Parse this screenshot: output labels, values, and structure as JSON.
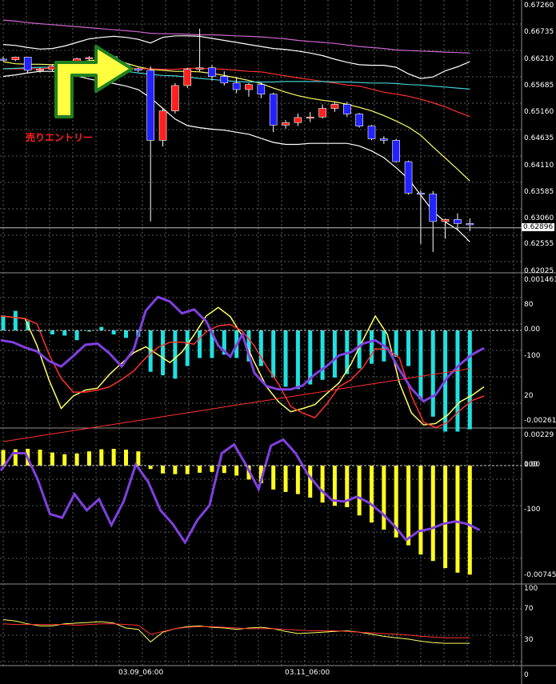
{
  "colors": {
    "background": "#000000",
    "grid": "#5a5a5a",
    "bull_candle": "#ff2020",
    "bear_candle": "#2222ff",
    "wick": "#ffffff",
    "bollinger": "#ffffff",
    "ma_fast": "#ffff66",
    "ma_mid": "#ff3030",
    "ma_cyan": "#40d0d0",
    "ma_slow": "#cc66cc",
    "osc_purple": "#8040e0",
    "histo_cyan": "#20e0e0",
    "histo_yellow": "#ffff20",
    "arrow_fill": "#ffff40",
    "arrow_border": "#208020",
    "entry_text": "#ff2020"
  },
  "annotation": {
    "entry_label": "売りエントリー"
  },
  "price_axis": {
    "labels": [
      "0.67260",
      "0.66735",
      "0.66210",
      "0.65685",
      "0.65160",
      "0.64635",
      "0.64110",
      "0.63585",
      "0.63060",
      "0.62555",
      "0.62025"
    ],
    "current_price": "0.62896"
  },
  "osc1_axis": {
    "labels": [
      "0.001461",
      "80",
      "0.00",
      "-100",
      "20",
      "-0.002618"
    ],
    "values": [
      0.001461,
      80,
      0,
      -100,
      20,
      -0.002618
    ]
  },
  "osc2_axis": {
    "labels": [
      "0.00229",
      "100",
      "0.00",
      "-100",
      "-0.00745"
    ],
    "values": [
      0.00229,
      100,
      0,
      -100,
      -0.00745
    ]
  },
  "osc3_axis": {
    "labels": [
      "100",
      "70",
      "30",
      "0"
    ],
    "values": [
      100,
      70,
      30,
      0
    ]
  },
  "time_axis": {
    "labels": [
      "03.09_06:00",
      "03.11_06:00"
    ]
  },
  "chart_data": [
    {
      "type": "candlestick",
      "ylim": [
        0.62025,
        0.6726
      ],
      "candles": [
        {
          "o": 0.6622,
          "h": 0.6627,
          "l": 0.6618,
          "c": 0.6621
        },
        {
          "o": 0.6621,
          "h": 0.6627,
          "l": 0.6618,
          "c": 0.6626
        },
        {
          "o": 0.6626,
          "h": 0.6626,
          "l": 0.6596,
          "c": 0.66
        },
        {
          "o": 0.66,
          "h": 0.6605,
          "l": 0.6595,
          "c": 0.6602
        },
        {
          "o": 0.6602,
          "h": 0.6612,
          "l": 0.6598,
          "c": 0.6608
        },
        {
          "o": 0.6608,
          "h": 0.6615,
          "l": 0.66,
          "c": 0.6612
        },
        {
          "o": 0.6612,
          "h": 0.6625,
          "l": 0.661,
          "c": 0.6623
        },
        {
          "o": 0.6623,
          "h": 0.6628,
          "l": 0.6619,
          "c": 0.6625
        },
        {
          "o": 0.6625,
          "h": 0.6633,
          "l": 0.6621,
          "c": 0.6627
        },
        {
          "o": 0.6627,
          "h": 0.6628,
          "l": 0.661,
          "c": 0.6612
        },
        {
          "o": 0.6612,
          "h": 0.6615,
          "l": 0.6602,
          "c": 0.6603
        },
        {
          "o": 0.6603,
          "h": 0.6605,
          "l": 0.6597,
          "c": 0.66
        },
        {
          "o": 0.66,
          "h": 0.6608,
          "l": 0.6302,
          "c": 0.6462
        },
        {
          "o": 0.6462,
          "h": 0.6525,
          "l": 0.645,
          "c": 0.652
        },
        {
          "o": 0.652,
          "h": 0.6575,
          "l": 0.6515,
          "c": 0.657
        },
        {
          "o": 0.657,
          "h": 0.6605,
          "l": 0.6565,
          "c": 0.6602
        },
        {
          "o": 0.6602,
          "h": 0.6682,
          "l": 0.6598,
          "c": 0.6605
        },
        {
          "o": 0.6605,
          "h": 0.661,
          "l": 0.658,
          "c": 0.6588
        },
        {
          "o": 0.6588,
          "h": 0.6598,
          "l": 0.657,
          "c": 0.6575
        },
        {
          "o": 0.6575,
          "h": 0.6586,
          "l": 0.6555,
          "c": 0.6562
        },
        {
          "o": 0.6562,
          "h": 0.6575,
          "l": 0.6548,
          "c": 0.6572
        },
        {
          "o": 0.6572,
          "h": 0.6576,
          "l": 0.6545,
          "c": 0.6553
        },
        {
          "o": 0.6553,
          "h": 0.6556,
          "l": 0.6478,
          "c": 0.6492
        },
        {
          "o": 0.6492,
          "h": 0.6502,
          "l": 0.6485,
          "c": 0.6497
        },
        {
          "o": 0.6497,
          "h": 0.6515,
          "l": 0.649,
          "c": 0.6507
        },
        {
          "o": 0.6507,
          "h": 0.6518,
          "l": 0.6498,
          "c": 0.6508
        },
        {
          "o": 0.6508,
          "h": 0.6533,
          "l": 0.6505,
          "c": 0.6525
        },
        {
          "o": 0.6525,
          "h": 0.6538,
          "l": 0.6518,
          "c": 0.6533
        },
        {
          "o": 0.6533,
          "h": 0.6538,
          "l": 0.6508,
          "c": 0.6514
        },
        {
          "o": 0.6514,
          "h": 0.6516,
          "l": 0.6487,
          "c": 0.649
        },
        {
          "o": 0.649,
          "h": 0.6492,
          "l": 0.6462,
          "c": 0.6465
        },
        {
          "o": 0.6465,
          "h": 0.647,
          "l": 0.6455,
          "c": 0.6462
        },
        {
          "o": 0.6462,
          "h": 0.6465,
          "l": 0.6418,
          "c": 0.642
        },
        {
          "o": 0.642,
          "h": 0.6422,
          "l": 0.6355,
          "c": 0.6358
        },
        {
          "o": 0.6358,
          "h": 0.6364,
          "l": 0.6258,
          "c": 0.6356
        },
        {
          "o": 0.6356,
          "h": 0.6362,
          "l": 0.6242,
          "c": 0.6302
        },
        {
          "o": 0.6302,
          "h": 0.6308,
          "l": 0.6268,
          "c": 0.6306
        },
        {
          "o": 0.6306,
          "h": 0.6318,
          "l": 0.6285,
          "c": 0.6298
        },
        {
          "o": 0.6298,
          "h": 0.6308,
          "l": 0.6283,
          "c": 0.6296
        }
      ],
      "series": [
        {
          "color": "#ffffff",
          "values": [
            0.6651,
            0.6649,
            0.6645,
            0.6642,
            0.6643,
            0.6648,
            0.6655,
            0.6662,
            0.6665,
            0.6667,
            0.6665,
            0.6661,
            0.6654,
            0.6665,
            0.6668,
            0.6668,
            0.6667,
            0.6663,
            0.6659,
            0.6655,
            0.6651,
            0.6647,
            0.6643,
            0.6641,
            0.6638,
            0.6634,
            0.6629,
            0.6622,
            0.6616,
            0.6611,
            0.661,
            0.661,
            0.6606,
            0.6593,
            0.6584,
            0.6587,
            0.6599,
            0.6607,
            0.6617
          ]
        },
        {
          "color": "#ffff66",
          "values": [
            0.6617,
            0.6613,
            0.6612,
            0.6612,
            0.6611,
            0.6613,
            0.6616,
            0.6619,
            0.6621,
            0.6622,
            0.6614,
            0.6607,
            0.6602,
            0.66,
            0.6598,
            0.6598,
            0.6597,
            0.6594,
            0.659,
            0.6585,
            0.658,
            0.6574,
            0.6565,
            0.6557,
            0.655,
            0.6545,
            0.6541,
            0.6538,
            0.6533,
            0.6527,
            0.652,
            0.6511,
            0.65,
            0.6488,
            0.6472,
            0.6449,
            0.6427,
            0.6405,
            0.6382
          ]
        },
        {
          "color": "#ff3030",
          "values": [
            0.6603,
            0.6603,
            0.6603,
            0.6603,
            0.6604,
            0.6605,
            0.6606,
            0.6607,
            0.6607,
            0.6607,
            0.6605,
            0.6603,
            0.6603,
            0.6602,
            0.6602,
            0.6604,
            0.6604,
            0.6603,
            0.6602,
            0.66,
            0.6598,
            0.6597,
            0.6593,
            0.6589,
            0.6585,
            0.6582,
            0.6578,
            0.6575,
            0.6571,
            0.6569,
            0.6563,
            0.6557,
            0.6553,
            0.6549,
            0.6543,
            0.6536,
            0.6528,
            0.6518,
            0.6509
          ]
        },
        {
          "color": "#40d0d0",
          "values": [
            0.6603,
            0.6604,
            0.6605,
            0.6606,
            0.6606,
            0.6605,
            0.6604,
            0.6602,
            0.6601,
            0.66,
            0.6598,
            0.6595,
            0.6592,
            0.659,
            0.6589,
            0.6587,
            0.6584,
            0.6582,
            0.658,
            0.6578,
            0.6577,
            0.6577,
            0.6577,
            0.6578,
            0.6578,
            0.6578,
            0.6578,
            0.6577,
            0.6577,
            0.6576,
            0.6575,
            0.6575,
            0.6574,
            0.6572,
            0.6571,
            0.6569,
            0.6567,
            0.6565,
            0.6563
          ]
        },
        {
          "color": "#ffffff",
          "values": [
            0.6588,
            0.6591,
            0.6595,
            0.6598,
            0.6598,
            0.6594,
            0.6589,
            0.6583,
            0.6578,
            0.6574,
            0.6569,
            0.6562,
            0.6546,
            0.6525,
            0.6504,
            0.6491,
            0.6487,
            0.6484,
            0.6482,
            0.6478,
            0.6474,
            0.6466,
            0.6458,
            0.6454,
            0.6454,
            0.6456,
            0.6456,
            0.6456,
            0.6456,
            0.6451,
            0.6441,
            0.6428,
            0.6408,
            0.6386,
            0.6354,
            0.6322,
            0.6301,
            0.6286,
            0.6262
          ]
        },
        {
          "color": "#cc66cc",
          "values": [
            0.6699,
            0.6697,
            0.6694,
            0.6692,
            0.669,
            0.6688,
            0.6686,
            0.6684,
            0.6682,
            0.668,
            0.6678,
            0.6676,
            0.6673,
            0.6672,
            0.6672,
            0.6671,
            0.667,
            0.667,
            0.6669,
            0.6668,
            0.6667,
            0.6666,
            0.6664,
            0.6662,
            0.6659,
            0.6657,
            0.6655,
            0.6653,
            0.665,
            0.6647,
            0.6645,
            0.6643,
            0.664,
            0.6639,
            0.6638,
            0.6637,
            0.6636,
            0.6635,
            0.6634
          ]
        }
      ]
    },
    {
      "type": "bar",
      "ylim": [
        -0.002618,
        0.001461
      ],
      "values": [
        0.00026,
        0.00034,
        0.00016,
        -2e-05,
        -7e-05,
        -9e-05,
        -0.00017,
        -2e-05,
        6e-05,
        -7e-05,
        -0.00013,
        -0.00011,
        -0.00072,
        -0.00078,
        -0.00084,
        -0.00062,
        -0.00048,
        -0.00048,
        -0.00042,
        -0.00048,
        -0.00054,
        -0.00062,
        -0.00082,
        -0.00098,
        -0.00102,
        -0.00094,
        -0.00086,
        -0.00082,
        -0.00076,
        -0.00066,
        -0.00058,
        -0.00054,
        -0.00046,
        -0.00062,
        -0.0012,
        -0.0015,
        -0.00176,
        -0.00176,
        -0.00172
      ]
    },
    {
      "type": "line",
      "ylim": [
        -200,
        100
      ],
      "series": [
        {
          "color": "#ffff66",
          "values": [
            22,
            20,
            18,
            -23,
            -76,
            -119,
            -100,
            -91,
            -88,
            -67,
            -50,
            -34,
            -25,
            -37,
            -49,
            -33,
            -7,
            22,
            35,
            21,
            -9,
            -49,
            -86,
            -109,
            -124,
            -119,
            -113,
            -96,
            -80,
            -51,
            -14,
            22,
            -6,
            -80,
            -126,
            -144,
            -142,
            -129,
            -109,
            -99,
            -86
          ]
        },
        {
          "color": "#ff3030",
          "values": [
            22,
            20,
            18,
            10,
            -37,
            -73,
            -94,
            -94,
            -91,
            -86,
            -75,
            -62,
            -42,
            -26,
            -18,
            -18,
            -21,
            -2,
            7,
            9,
            -1,
            -24,
            -55,
            -82,
            -116,
            -126,
            -133,
            -112,
            -86,
            -75,
            -56,
            -28,
            -29,
            -42,
            -100,
            -140,
            -148,
            -140,
            -122,
            -107,
            -100
          ]
        },
        {
          "color": "#8040e0",
          "values": [
            -15,
            -18,
            -26,
            -32,
            -47,
            -55,
            -39,
            -22,
            -20,
            -35,
            -55,
            -29,
            30,
            51,
            44,
            26,
            32,
            14,
            -23,
            -40,
            -6,
            -65,
            -85,
            -90,
            -90,
            -84,
            -67,
            -54,
            -38,
            -33,
            -20,
            -15,
            -27,
            -60,
            -89,
            -108,
            -98,
            -71,
            -52,
            -37,
            -27
          ]
        },
        {
          "color": "#8040e0",
          "values": [
            -24,
            -10,
            -10,
            -31,
            -59,
            -62,
            -43,
            -56,
            -47,
            -68,
            -49,
            -19,
            -33,
            -56,
            -67,
            -82,
            -64,
            -52,
            -10,
            -3,
            -20,
            -39,
            -4,
            1,
            -10,
            -27,
            -39,
            -48,
            -49,
            -45,
            -50,
            -58,
            -68,
            -80,
            -73,
            -71,
            -67,
            -65,
            -67,
            -72
          ]
        }
      ]
    },
    {
      "type": "bar",
      "ylim": [
        -0.00745,
        0.00229
      ],
      "values": [
        0.0011,
        0.00115,
        0.00118,
        0.00112,
        0.00092,
        0.0008,
        0.00085,
        0.001,
        0.00115,
        0.00118,
        0.00112,
        0.001,
        -0.00024,
        -0.00055,
        -0.0006,
        -0.0006,
        -0.0005,
        -0.00044,
        -0.00052,
        -0.0007,
        -0.00098,
        -0.00124,
        -0.00168,
        -0.00185,
        -0.002,
        -0.00225,
        -0.0026,
        -0.00282,
        -0.00292,
        -0.0035,
        -0.004,
        -0.0045,
        -0.00505,
        -0.0056,
        -0.00625,
        -0.0067,
        -0.0072,
        -0.00752,
        -0.00766
      ]
    },
    {
      "type": "line",
      "ylim": [
        0,
        100
      ],
      "series": [
        {
          "color": "#ffff66",
          "values": [
            58,
            56,
            52,
            49,
            49,
            52,
            53,
            54,
            55,
            53,
            46,
            44,
            26,
            40,
            45,
            48,
            49,
            47,
            46,
            44,
            46,
            47,
            45,
            41,
            38,
            39,
            40,
            41,
            42,
            40,
            37,
            34,
            32,
            30,
            27,
            25,
            24,
            24,
            24
          ]
        },
        {
          "color": "#ff3030",
          "values": [
            52,
            51,
            51,
            51,
            51,
            51,
            50,
            51,
            52,
            52,
            51,
            50,
            37,
            41,
            45,
            47,
            48,
            48,
            47,
            46,
            45,
            45,
            45,
            44,
            43,
            42,
            42,
            42,
            41,
            40,
            39,
            38,
            37,
            36,
            34,
            33,
            32,
            32,
            32
          ]
        }
      ]
    }
  ]
}
